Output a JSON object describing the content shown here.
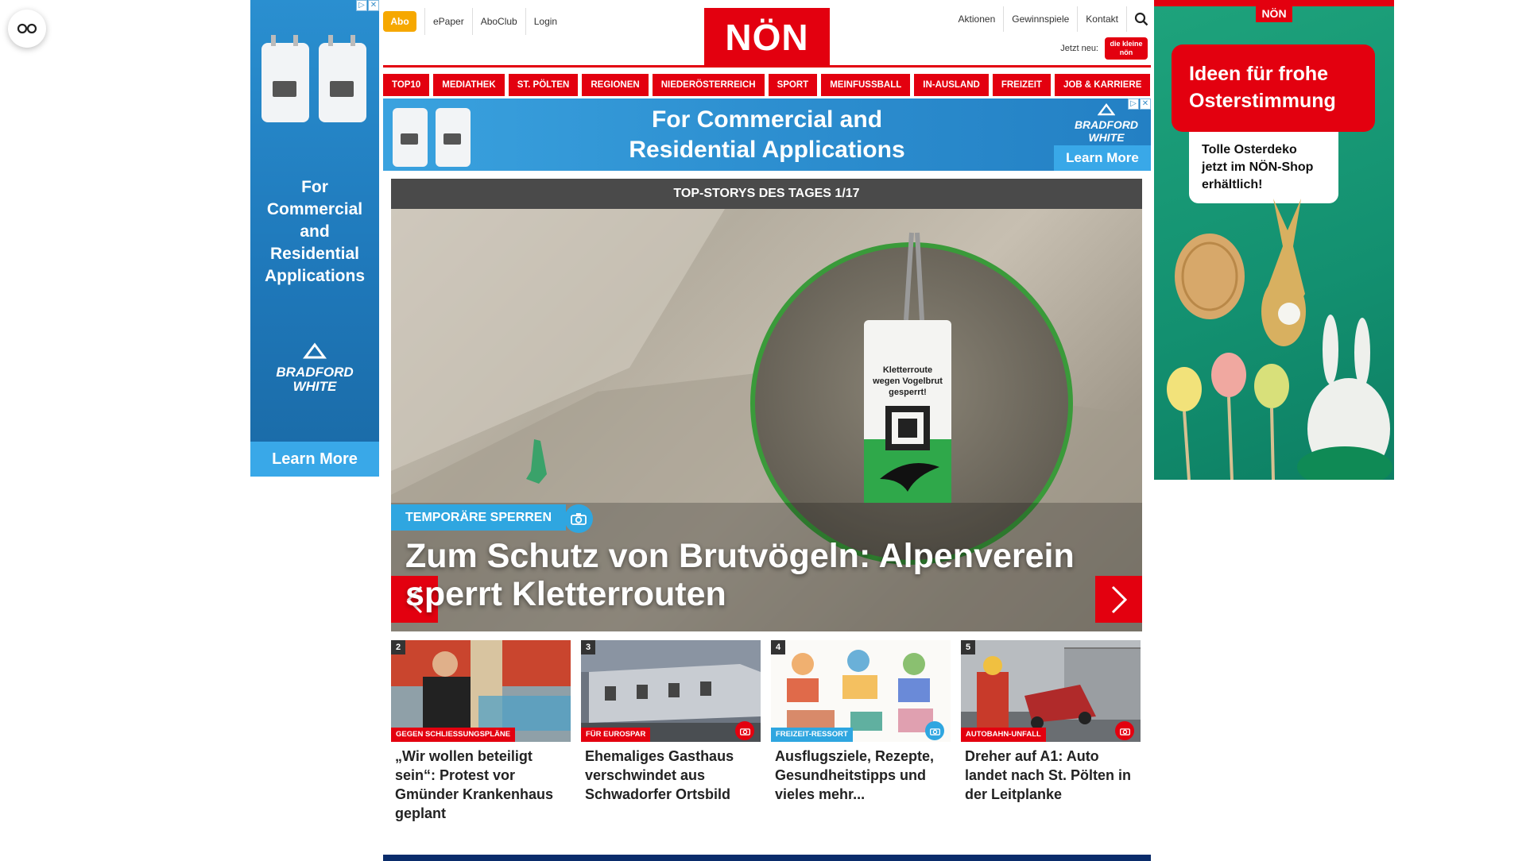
{
  "header": {
    "abo": "Abo",
    "top_links": [
      "ePaper",
      "AboClub",
      "Login"
    ],
    "logo": "NÖN",
    "right_links": [
      "Aktionen",
      "Gewinnspiele",
      "Kontakt"
    ],
    "jetzt_neu": "Jetzt neu:",
    "jetzt_badge": "die kleine nön"
  },
  "nav": [
    "TOP10",
    "MEDIATHEK",
    "ST. PÖLTEN",
    "REGIONEN",
    "NIEDERÖSTERREICH",
    "SPORT",
    "MEINFUSSBALL",
    "IN-AUSLAND",
    "FREIZEIT",
    "JOB & KARRIERE"
  ],
  "ad_left": {
    "copy": "For Commercial and Residential Applications",
    "brand_line1": "BRADFORD",
    "brand_line2": "WHITE",
    "cta": "Learn More"
  },
  "ad_top": {
    "copy_line1": "For Commercial and",
    "copy_line2": "Residential Applications",
    "brand_line1": "BRADFORD",
    "brand_line2": "WHITE",
    "cta": "Learn More"
  },
  "ad_right": {
    "logo": "NÖN",
    "headline": "Ideen für frohe Osterstimmung",
    "note": "Tolle Osterdeko jetzt im NÖN-Shop erhältlich!"
  },
  "slider": {
    "bar": "TOP-STORYS DES TAGES 1/17",
    "tag": "TEMPORÄRE SPERREN",
    "headline": "Zum Schutz von Brutvögeln: Alpenverein sperrt Kletterrouten",
    "sign_line1": "Kletterroute",
    "sign_line2": "wegen Vogelbrut",
    "sign_line3": "gesperrt!"
  },
  "teasers": [
    {
      "num": "2",
      "category": "GEGEN SCHLIESSUNGSPLÄNE",
      "title": "„Wir wollen beteiligt sein“: Protest vor Gmünder Krankenhaus geplant",
      "cat_color": "#e3000f",
      "icon": "none"
    },
    {
      "num": "3",
      "category": "FÜR EUROSPAR",
      "title": "Ehemaliges Gasthaus verschwindet aus Schwadorfer Ortsbild",
      "cat_color": "#e3000f",
      "icon": "camera-icon"
    },
    {
      "num": "4",
      "category": "FREIZEIT-RESSORT",
      "title": "Ausflugsziele, Rezepte, Gesundheitstipps und vieles mehr...",
      "cat_color": "#2fa6e0",
      "icon": "camera-icon"
    },
    {
      "num": "5",
      "category": "AUTOBAHN-UNFALL",
      "title": "Dreher auf A1: Auto landet nach St. Pölten in der Leitplanke",
      "cat_color": "#e3000f",
      "icon": "camera-icon"
    }
  ],
  "colors": {
    "brand_red": "#e3000f",
    "accent_blue": "#2fa6e0",
    "abo_orange": "#f6a800"
  }
}
